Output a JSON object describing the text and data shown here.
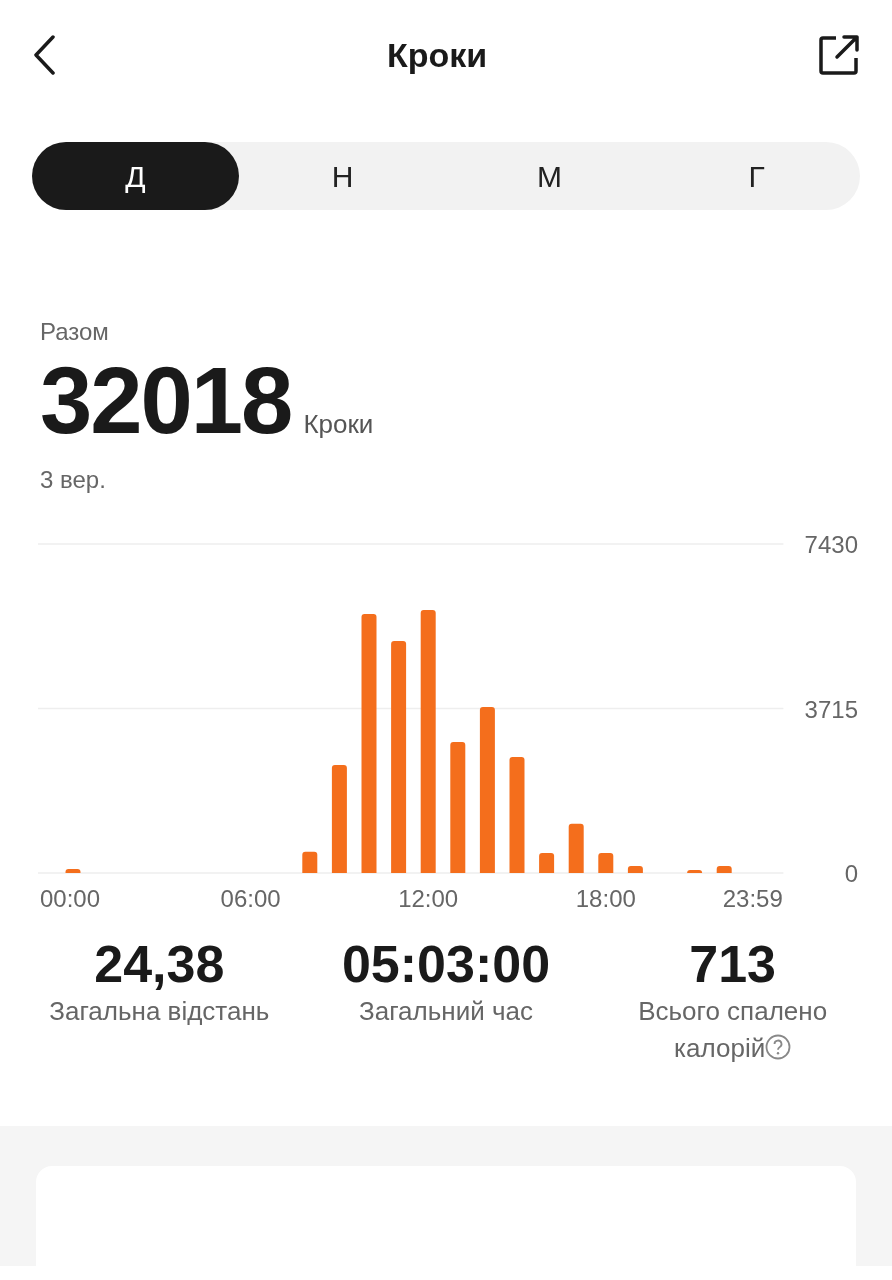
{
  "header": {
    "title": "Кроки"
  },
  "tabs": [
    {
      "label": "Д",
      "selected": true
    },
    {
      "label": "Н",
      "selected": false
    },
    {
      "label": "М",
      "selected": false
    },
    {
      "label": "Г",
      "selected": false
    }
  ],
  "summary": {
    "label": "Разом",
    "value": "32018",
    "unit": "Кроки",
    "date": "3 вер."
  },
  "chart": {
    "chart_data": {
      "type": "bar",
      "x": [
        0,
        1,
        2,
        3,
        4,
        5,
        6,
        7,
        8,
        9,
        10,
        11,
        12,
        13,
        14,
        15,
        16,
        17,
        18,
        19,
        20,
        21,
        22,
        23
      ],
      "series": [
        {
          "color": "#f46e1c",
          "values": [
            90,
            0,
            0,
            0,
            0,
            0,
            0,
            0,
            480,
            2440,
            5850,
            5240,
            5940,
            2960,
            3750,
            2620,
            450,
            1110,
            450,
            160,
            0,
            70,
            160,
            0
          ]
        }
      ],
      "xlim": [
        0,
        24
      ],
      "ylim": [
        0,
        7430
      ],
      "xticks": [
        {
          "value": 0,
          "label": "00:00"
        },
        {
          "value": 6,
          "label": "06:00"
        },
        {
          "value": 12,
          "label": "12:00"
        },
        {
          "value": 18,
          "label": "18:00"
        },
        {
          "value": 23.98,
          "label": "23:59"
        }
      ],
      "yticks": [
        0,
        3715,
        7430
      ]
    }
  },
  "stats": [
    {
      "value": "24,38",
      "label": "Загальна відстань",
      "help": false
    },
    {
      "value": "05:03:00",
      "label": "Загальний час",
      "help": false
    },
    {
      "value": "713",
      "label": "Всього спалено калорій",
      "help": true
    }
  ]
}
